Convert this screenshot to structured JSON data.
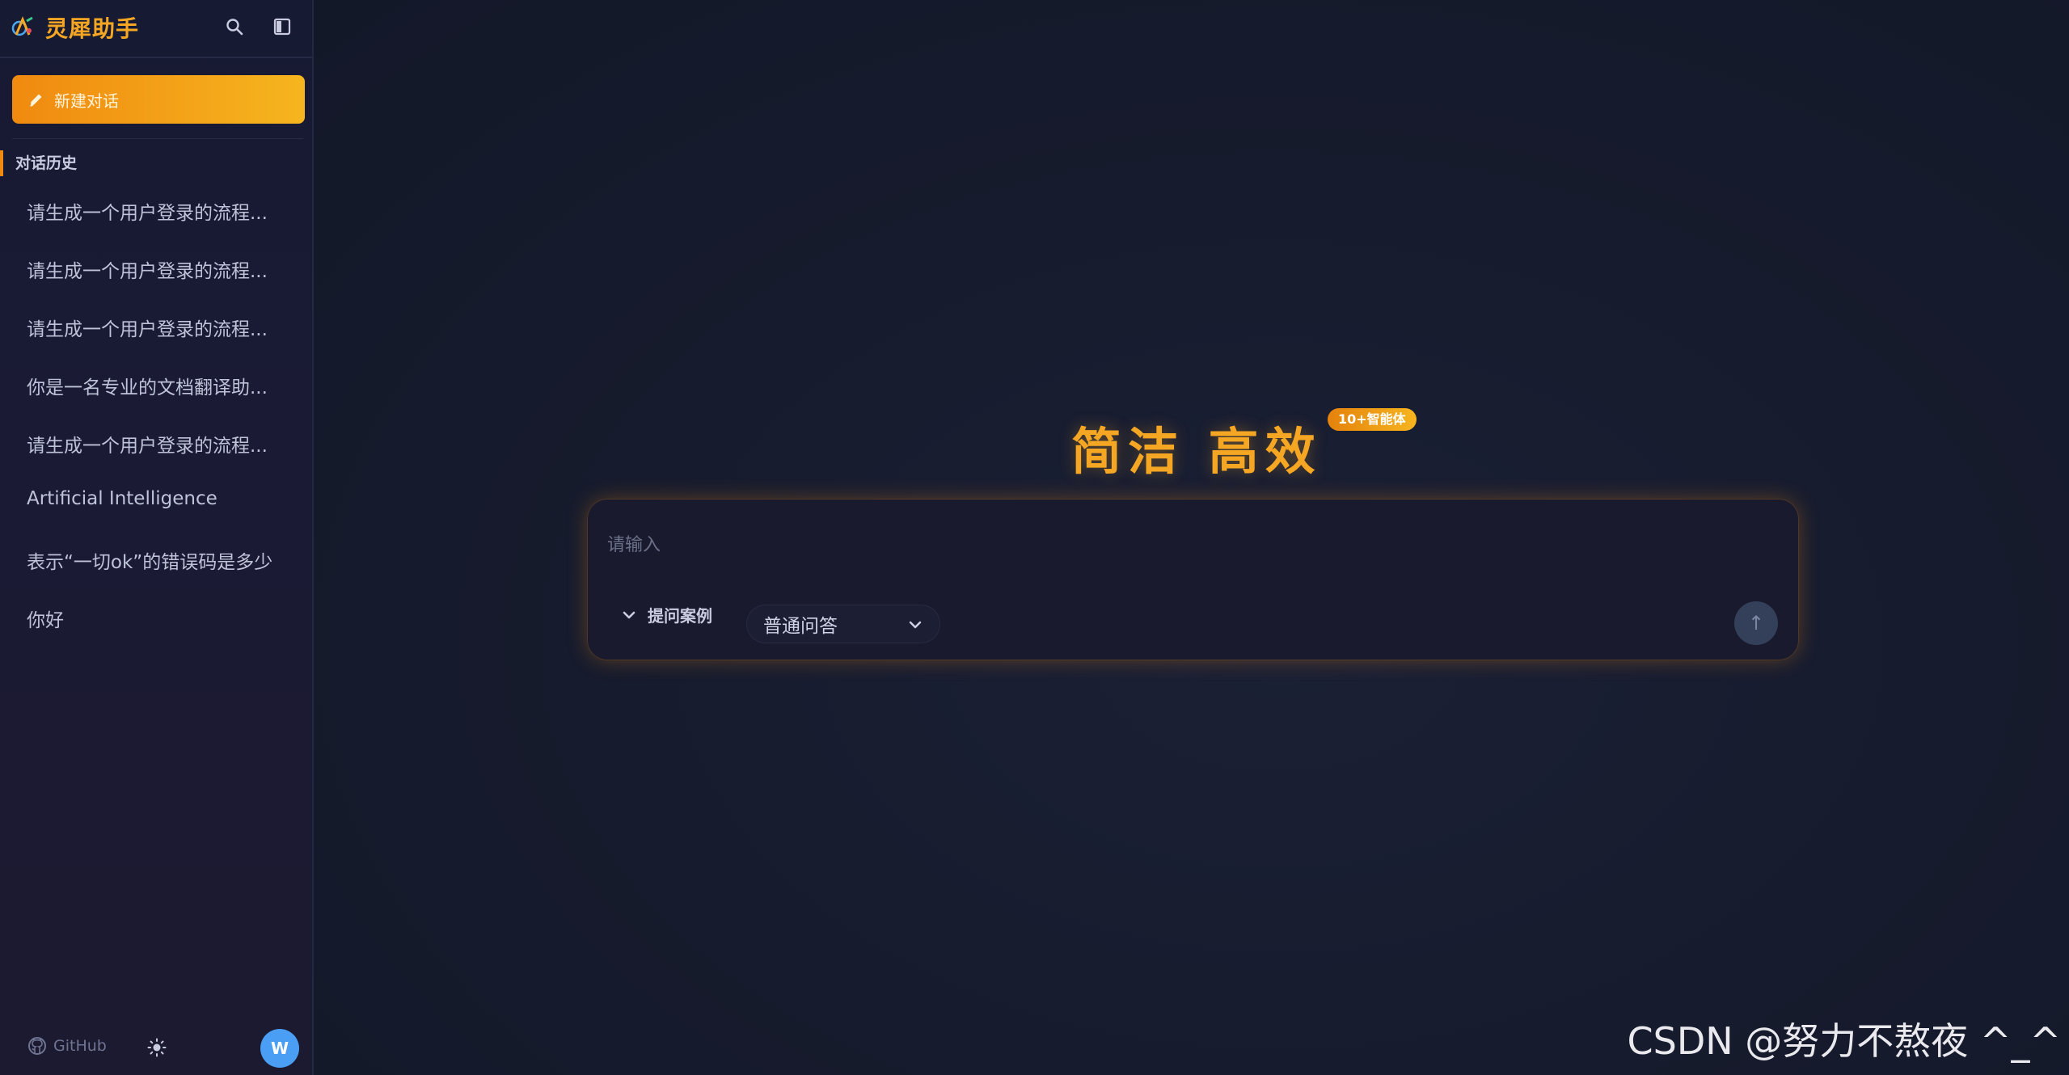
{
  "sidebar": {
    "app_title": "灵犀助手",
    "new_chat_label": "新建对话",
    "history_title": "对话历史",
    "history": [
      "请生成一个用户登录的流程...",
      "请生成一个用户登录的流程...",
      "请生成一个用户登录的流程...",
      "你是一名专业的文档翻译助...",
      "请生成一个用户登录的流程...",
      "Artificial Intelligence",
      "表示“一切ok”的错误码是多少",
      "你好"
    ],
    "github_label": "GitHub",
    "avatar_initial": "W"
  },
  "main": {
    "hero_title": "简洁 高效",
    "badge": "10+智能体",
    "input_placeholder": "请输入",
    "examples_label": "提问案例",
    "mode_selected": "普通问答",
    "send_glyph": "↑"
  },
  "watermark": "CSDN @努力不熬夜 ^_^",
  "colors": {
    "accent": "#f5a623",
    "sidebar_bg": "#1a1a34",
    "main_bg": "#161b2d",
    "avatar_bg": "#4a9ff5"
  },
  "icons": {
    "logo": "app-logo-icon",
    "search": "search-icon",
    "sidebar_toggle": "sidebar-toggle-icon",
    "new_chat": "pencil-icon",
    "github": "github-icon",
    "theme": "sun-icon",
    "examples": "chevron-down-icon",
    "mode": "chevron-down-icon",
    "send": "arrow-up-icon"
  }
}
